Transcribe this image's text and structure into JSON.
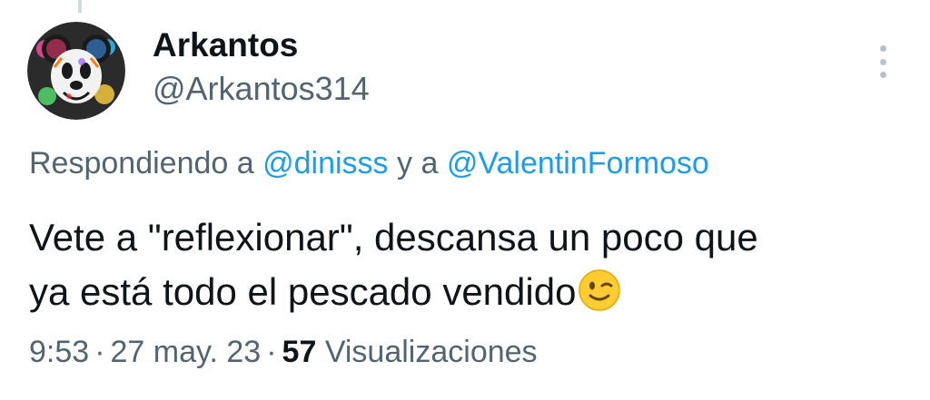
{
  "tweet": {
    "author": {
      "display_name": "Arkantos",
      "handle": "@Arkantos314"
    },
    "reply": {
      "prefix": "Respondiendo a",
      "mention1": "@dinisss",
      "joiner": "y a",
      "mention2": "@ValentinFormoso"
    },
    "text": {
      "line1": "Vete a \"reflexionar\", descansa un poco que",
      "line2": "ya está todo el pescado vendido"
    },
    "emoji": "winking-face",
    "meta": {
      "time": "9:53",
      "separator": "·",
      "date": "27 may. 23",
      "views_count": "57",
      "views_label": "Visualizaciones"
    }
  },
  "colors": {
    "text": "#0f1419",
    "secondary": "#536471",
    "link": "#1d9bf0"
  }
}
